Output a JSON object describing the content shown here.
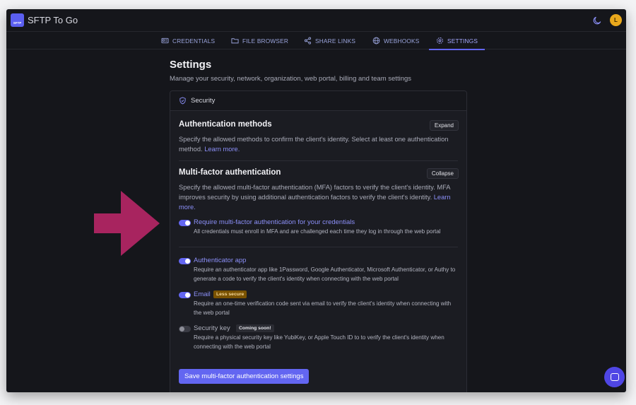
{
  "app": {
    "title": "SFTP To Go",
    "logo_text": "SFTP",
    "avatar_letter": "L"
  },
  "tabs": [
    {
      "label": "CREDENTIALS",
      "icon": "id-card-icon"
    },
    {
      "label": "FILE BROWSER",
      "icon": "folder-icon"
    },
    {
      "label": "SHARE LINKS",
      "icon": "share-icon"
    },
    {
      "label": "WEBHOOKS",
      "icon": "globe-icon"
    },
    {
      "label": "SETTINGS",
      "icon": "gear-icon",
      "active": true
    }
  ],
  "page": {
    "title": "Settings",
    "subtitle": "Manage your security, network, organization, web portal, billing and team settings"
  },
  "security": {
    "header": "Security",
    "auth_methods": {
      "title": "Authentication methods",
      "button": "Expand",
      "desc": "Specify the allowed methods to confirm the client's identity. Select at least one authentication method.",
      "link": "Learn more."
    },
    "mfa": {
      "title": "Multi-factor authentication",
      "button": "Collapse",
      "desc": "Specify the allowed multi-factor authentication (MFA) factors to verify the client's identity. MFA improves security by using additional authentication factors to verify the client's identity.",
      "link": "Learn more.",
      "require": {
        "label": "Require multi-factor authentication for your credentials",
        "desc": "All credentials must enroll in MFA and are challenged each time they log in through the web portal",
        "enabled": true
      },
      "factors": [
        {
          "label": "Authenticator app",
          "desc": "Require an authenticator app like 1Password, Google Authenticator, Microsoft Authenticator, or Authy to generate a code to verify the client's identity when connecting with the web portal",
          "enabled": true
        },
        {
          "label": "Email",
          "badge": "Less secure",
          "desc": "Require an one-time verification code sent via email to verify the client's identity when connecting with the web portal",
          "enabled": true
        },
        {
          "label": "Security key",
          "badge": "Coming soon!",
          "desc": "Require a physical security key like YubiKey, or Apple Touch ID to to verify the client's identity when connecting with the web portal",
          "enabled": false
        }
      ],
      "save_label": "Save multi-factor authentication settings"
    }
  },
  "colors": {
    "accent": "#6366f1",
    "arrow": "#a8245f",
    "background": "#15161b"
  }
}
